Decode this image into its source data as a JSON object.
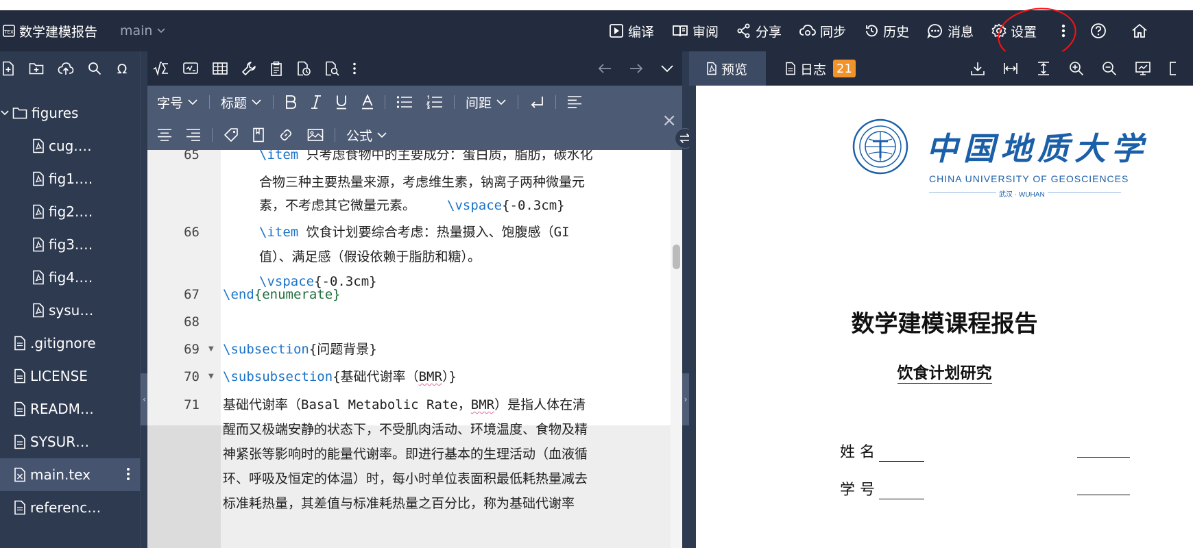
{
  "project": {
    "icon": "tex-logo-icon",
    "name": "数学建模报告",
    "branch": "main"
  },
  "header_menu": [
    {
      "icon": "play-icon",
      "label": "编译"
    },
    {
      "icon": "book-icon",
      "label": "审阅"
    },
    {
      "icon": "share-icon",
      "label": "分享"
    },
    {
      "icon": "cloud-sync-icon",
      "label": "同步"
    },
    {
      "icon": "history-icon",
      "label": "历史"
    },
    {
      "icon": "message-icon",
      "label": "消息"
    },
    {
      "icon": "gear-icon",
      "label": "设置"
    }
  ],
  "annotation_color": "#ff1010",
  "file_tree": {
    "folder": "figures",
    "children": [
      "cug.…",
      "fig1.…",
      "fig2.…",
      "fig3.…",
      "fig4.…",
      "sysu…"
    ],
    "files": [
      ".gitignore",
      "LICENSE",
      "READM…",
      "SYSUR…",
      "main.tex",
      "referenc…"
    ],
    "active_file": "main.tex"
  },
  "format_bar": {
    "font_size": "字号",
    "heading": "标题",
    "spacing": "间距",
    "formula": "公式"
  },
  "code": {
    "line_numbers": [
      "65",
      "66",
      "67",
      "68",
      "69",
      "70",
      "71"
    ],
    "line65_cmd": "\\item",
    "line65_text1": " 只考虑食物中的主要成分：蛋白质，脂肪，碳水化",
    "line65_text2": "合物三种主要热量来源，考虑维生素，钠离子两种微量元",
    "line65_text3": "素，不考虑其它微量元素。",
    "line65_vspace_cmd": "\\vspace",
    "line65_vspace_arg": "{-0.3cm}",
    "line66_cmd": "\\item",
    "line66_text1": " 饮食计划要综合考虑：热量摄入、饱腹感（GI",
    "line66_text2": "值）、满足感（假设依赖于脂肪和糖）。",
    "line66_vspace_cmd": "\\vspace",
    "line66_vspace_arg": "{-0.3cm}",
    "line67_cmd": "\\end",
    "line67_arg": "{enumerate}",
    "line69_cmd": "\\subsection",
    "line69_arg": "{问题背景}",
    "line70_cmd": "\\subsubsection",
    "line70_arg_pre": "{基础代谢率（",
    "line70_arg_u": "BMR",
    "line70_arg_post": "）}",
    "line71_text1_pre": "基础代谢率（Basal Metabolic Rate，",
    "line71_text1_u": "BMR",
    "line71_text1_post": "）是指人体在清",
    "line71_text2": "醒而又极端安静的状态下，不受肌肉活动、环境温度、食物及精",
    "line71_text3": "神紧张等影响时的能量代谢率。即进行基本的生理活动（血液循",
    "line71_text4": "环、呼吸及恒定的体温）时，每小时单位表面积最低耗热量减去",
    "line71_text5": "标准耗热量，其差值与标准耗热量之百分比，称为基础代谢率"
  },
  "preview": {
    "tab_preview": "预览",
    "tab_log": "日志",
    "log_count": "21",
    "logo_cn": "中国地质大学",
    "logo_en": "CHINA UNIVERSITY OF GEOSCIENCES",
    "logo_city": "武汉 · WUHAN",
    "title": "数学建模课程报告",
    "subtitle": "饮食计划研究",
    "name_label": "姓 名",
    "id_label": "学 号"
  }
}
